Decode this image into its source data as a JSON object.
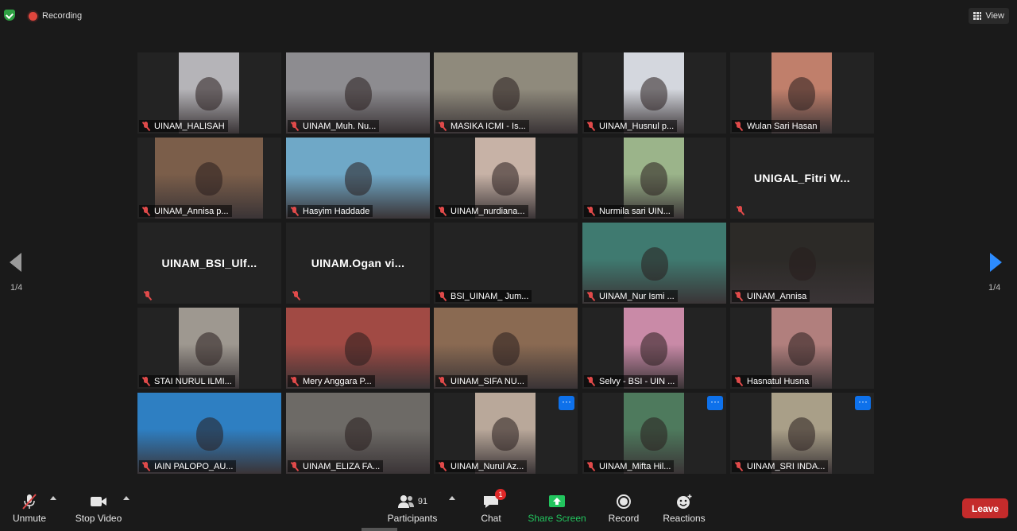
{
  "topbar": {
    "recording_label": "Recording",
    "view_label": "View"
  },
  "pagination": {
    "prev_indicator": "1/4",
    "next_indicator": "1/4"
  },
  "tiles": [
    {
      "name": "UINAM_HALISAH",
      "bg": "#b5b4b8",
      "video": true,
      "vx": 52,
      "vw": 76
    },
    {
      "name": "UINAM_Muh. Nu...",
      "bg": "#8d8c90",
      "video": true,
      "vx": 0,
      "vw": 181
    },
    {
      "name": "MASIKA ICMI - Is...",
      "bg": "#8f8a7c",
      "video": true,
      "vx": 0,
      "vw": 181
    },
    {
      "name": "UINAM_Husnul p...",
      "bg": "#d4d7de",
      "video": true,
      "vx": 52,
      "vw": 76
    },
    {
      "name": "Wulan Sari Hasan",
      "bg": "#c07f6b",
      "video": true,
      "vx": 52,
      "vw": 76
    },
    {
      "name": "UINAM_Annisa p...",
      "bg": "#7b5e4a",
      "video": true,
      "vx": 22,
      "vw": 136
    },
    {
      "name": "Hasyim Haddade",
      "bg": "#6fa8c7",
      "video": true,
      "vx": 0,
      "vw": 181,
      "active": true
    },
    {
      "name": "UINAM_nurdiana...",
      "bg": "#c7b2a6",
      "video": true,
      "vx": 52,
      "vw": 76
    },
    {
      "name": "Nurmila sari UIN...",
      "bg": "#9bb48a",
      "video": true,
      "vx": 52,
      "vw": 76
    },
    {
      "name": "UNIGAL_Fitri W...",
      "video": false
    },
    {
      "name": "UINAM_BSI_Ulf...",
      "video": false
    },
    {
      "name": "UINAM.Ogan  vi...",
      "video": false
    },
    {
      "name": "BSI_UINAM_ Jum...",
      "bg": "#232323",
      "video": false,
      "labelled": true
    },
    {
      "name": "UINAM_Nur Ismi ...",
      "bg": "#3f7a70",
      "video": true,
      "vx": 0,
      "vw": 181
    },
    {
      "name": "UINAM_Annisa",
      "bg": "#2c2a27",
      "video": true,
      "vx": 0,
      "vw": 181
    },
    {
      "name": "STAI NURUL ILMI...",
      "bg": "#9e9890",
      "video": true,
      "vx": 52,
      "vw": 76
    },
    {
      "name": "Mery Anggara P...",
      "bg": "#a14a44",
      "video": true,
      "vx": 0,
      "vw": 181
    },
    {
      "name": "UINAM_SIFA NU...",
      "bg": "#8a6a52",
      "video": true,
      "vx": 0,
      "vw": 181
    },
    {
      "name": "Selvy - BSI - UIN ...",
      "bg": "#c98aa7",
      "video": true,
      "vx": 52,
      "vw": 76
    },
    {
      "name": "Hasnatul Husna",
      "bg": "#b17f7d",
      "video": true,
      "vx": 52,
      "vw": 76
    },
    {
      "name": "IAIN PALOPO_AU...",
      "bg": "#2e7fc2",
      "video": true,
      "vx": 0,
      "vw": 181
    },
    {
      "name": "UINAM_ELIZA FA...",
      "bg": "#6d6a66",
      "video": true,
      "vx": 0,
      "vw": 181
    },
    {
      "name": "UINAM_Nurul Az...",
      "bg": "#b9a89a",
      "video": true,
      "vx": 52,
      "vw": 76,
      "more": true
    },
    {
      "name": "UINAM_Mifta Hil...",
      "bg": "#4e7a5d",
      "video": true,
      "vx": 52,
      "vw": 76,
      "more": true
    },
    {
      "name": "UINAM_SRI INDA...",
      "bg": "#a99f88",
      "video": true,
      "vx": 52,
      "vw": 76,
      "more": true
    }
  ],
  "toolbar": {
    "unmute_label": "Unmute",
    "stop_video_label": "Stop Video",
    "participants_label": "Participants",
    "participants_count": "91",
    "chat_label": "Chat",
    "chat_badge": "1",
    "share_screen_label": "Share Screen",
    "record_label": "Record",
    "reactions_label": "Reactions",
    "leave_label": "Leave"
  },
  "colors": {
    "share_green": "#22c55e",
    "leave_red": "#c42b2b",
    "active_speaker": "#d6d44a",
    "accent_blue": "#2d8cff"
  }
}
